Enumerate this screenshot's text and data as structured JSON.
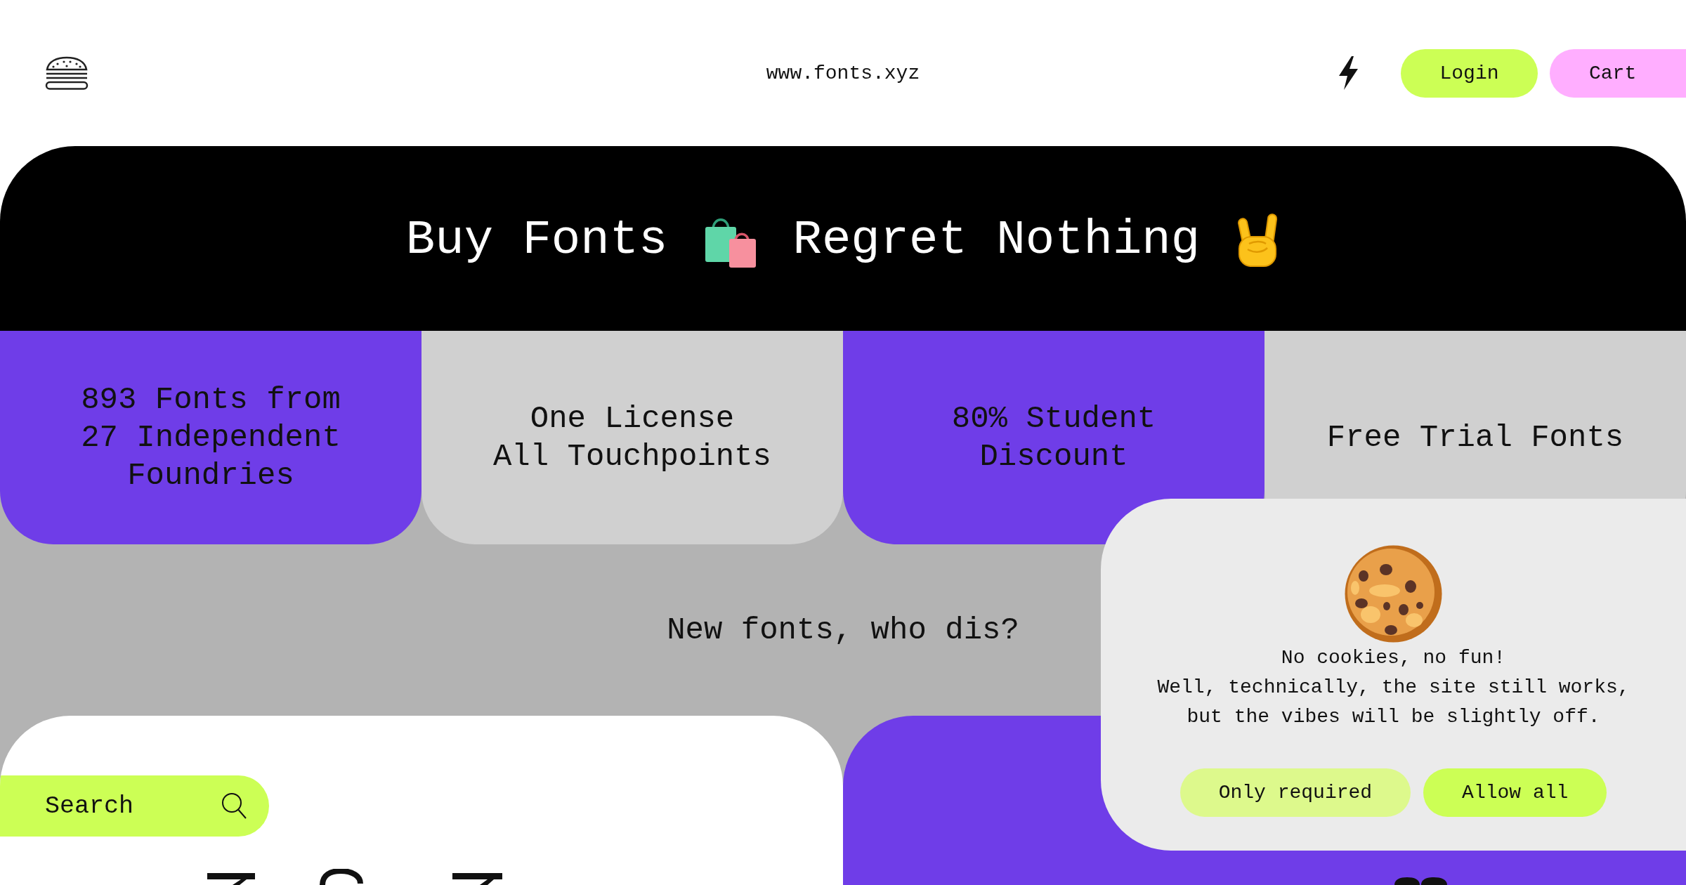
{
  "header": {
    "site_url": "www.fonts.xyz",
    "buttons": [
      {
        "label": "Login",
        "color": "#ccff55"
      },
      {
        "label": "Cart",
        "color": "#ffaeff"
      }
    ]
  },
  "hero": {
    "headline": [
      "Buy Fonts",
      "Regret Nothing"
    ]
  },
  "features": [
    {
      "text": "893 Fonts from\n27 Independent\nFoundries"
    },
    {
      "text": "One License\nAll Touchpoints"
    },
    {
      "text": "80% Student\nDiscount"
    },
    {
      "text": "Free Trial Fonts"
    }
  ],
  "tagline": "New fonts, who dis?",
  "search": {
    "placeholder": "Search"
  },
  "cookie_banner": {
    "title": "No cookies, no fun!",
    "message": "Well, technically, the site still works, but the vibes will be slightly off.",
    "buttons": [
      {
        "label": "Only required",
        "color": "#ddf98c"
      },
      {
        "label": "Allow all",
        "color": "#ccff55"
      }
    ]
  }
}
